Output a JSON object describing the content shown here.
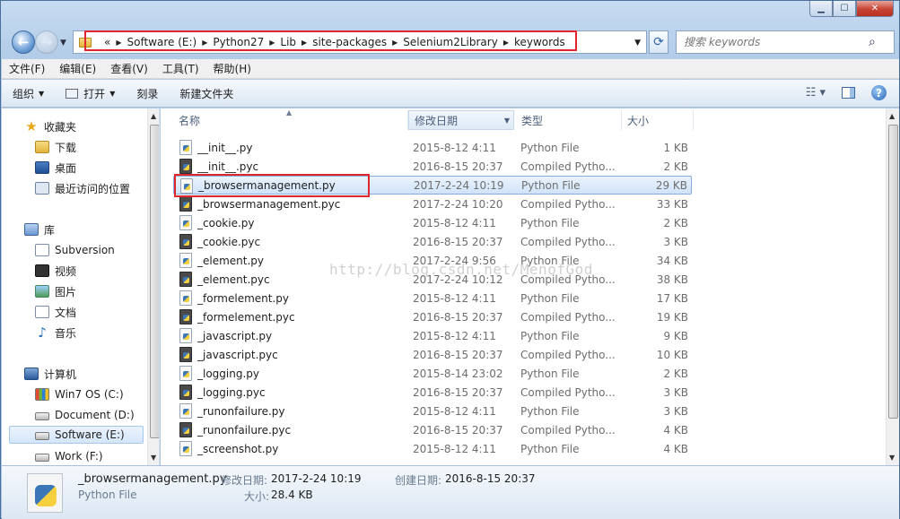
{
  "window": {
    "min_label": "▁",
    "max_label": "☐",
    "close_label": "✕"
  },
  "address": {
    "prefix": "«",
    "crumbs": [
      "Software (E:)",
      "Python27",
      "Lib",
      "site-packages",
      "Selenium2Library",
      "keywords"
    ]
  },
  "search": {
    "placeholder": "搜索 keywords"
  },
  "menu": [
    "文件(F)",
    "编辑(E)",
    "查看(V)",
    "工具(T)",
    "帮助(H)"
  ],
  "toolbar": {
    "organize": "组织",
    "open": "打开",
    "burn": "刻录",
    "new_folder": "新建文件夹"
  },
  "nav": {
    "favorites": "收藏夹",
    "downloads": "下载",
    "desktop": "桌面",
    "recent": "最近访问的位置",
    "libraries": "库",
    "subversion": "Subversion",
    "videos": "视频",
    "pictures": "图片",
    "documents": "文档",
    "music": "音乐",
    "computer": "计算机",
    "drive_c": "Win7 OS (C:)",
    "drive_d": "Document (D:)",
    "drive_e": "Software (E:)",
    "drive_f": "Work (F:)"
  },
  "columns": {
    "name": "名称",
    "date": "修改日期",
    "type": "类型",
    "size": "大小"
  },
  "files": [
    {
      "name": "__init__.py",
      "date": "2015-8-12 4:11",
      "type": "Python File",
      "size": "1 KB",
      "kind": "py"
    },
    {
      "name": "__init__.pyc",
      "date": "2016-8-15 20:37",
      "type": "Compiled Pytho...",
      "size": "2 KB",
      "kind": "pyc"
    },
    {
      "name": "_browsermanagement.py",
      "date": "2017-2-24 10:19",
      "type": "Python File",
      "size": "29 KB",
      "kind": "py"
    },
    {
      "name": "_browsermanagement.pyc",
      "date": "2017-2-24 10:20",
      "type": "Compiled Pytho...",
      "size": "33 KB",
      "kind": "pyc"
    },
    {
      "name": "_cookie.py",
      "date": "2015-8-12 4:11",
      "type": "Python File",
      "size": "2 KB",
      "kind": "py"
    },
    {
      "name": "_cookie.pyc",
      "date": "2016-8-15 20:37",
      "type": "Compiled Pytho...",
      "size": "3 KB",
      "kind": "pyc"
    },
    {
      "name": "_element.py",
      "date": "2017-2-24 9:56",
      "type": "Python File",
      "size": "34 KB",
      "kind": "py"
    },
    {
      "name": "_element.pyc",
      "date": "2017-2-24 10:12",
      "type": "Compiled Pytho...",
      "size": "38 KB",
      "kind": "pyc"
    },
    {
      "name": "_formelement.py",
      "date": "2015-8-12 4:11",
      "type": "Python File",
      "size": "17 KB",
      "kind": "py"
    },
    {
      "name": "_formelement.pyc",
      "date": "2016-8-15 20:37",
      "type": "Compiled Pytho...",
      "size": "19 KB",
      "kind": "pyc"
    },
    {
      "name": "_javascript.py",
      "date": "2015-8-12 4:11",
      "type": "Python File",
      "size": "9 KB",
      "kind": "py"
    },
    {
      "name": "_javascript.pyc",
      "date": "2016-8-15 20:37",
      "type": "Compiled Pytho...",
      "size": "10 KB",
      "kind": "pyc"
    },
    {
      "name": "_logging.py",
      "date": "2015-8-14 23:02",
      "type": "Python File",
      "size": "2 KB",
      "kind": "py"
    },
    {
      "name": "_logging.pyc",
      "date": "2016-8-15 20:37",
      "type": "Compiled Pytho...",
      "size": "3 KB",
      "kind": "pyc"
    },
    {
      "name": "_runonfailure.py",
      "date": "2015-8-12 4:11",
      "type": "Python File",
      "size": "3 KB",
      "kind": "py"
    },
    {
      "name": "_runonfailure.pyc",
      "date": "2016-8-15 20:37",
      "type": "Compiled Pytho...",
      "size": "4 KB",
      "kind": "pyc"
    },
    {
      "name": "_screenshot.py",
      "date": "2015-8-12 4:11",
      "type": "Python File",
      "size": "4 KB",
      "kind": "py"
    }
  ],
  "selected_index": 2,
  "watermark": "http://blog.csdn.net/MenofGod",
  "details": {
    "filename": "_browsermanagement.py",
    "filetype": "Python File",
    "modified_label": "修改日期:",
    "modified_value": "2017-2-24 10:19",
    "created_label": "创建日期:",
    "created_value": "2016-8-15 20:37",
    "size_label": "大小:",
    "size_value": "28.4 KB"
  }
}
